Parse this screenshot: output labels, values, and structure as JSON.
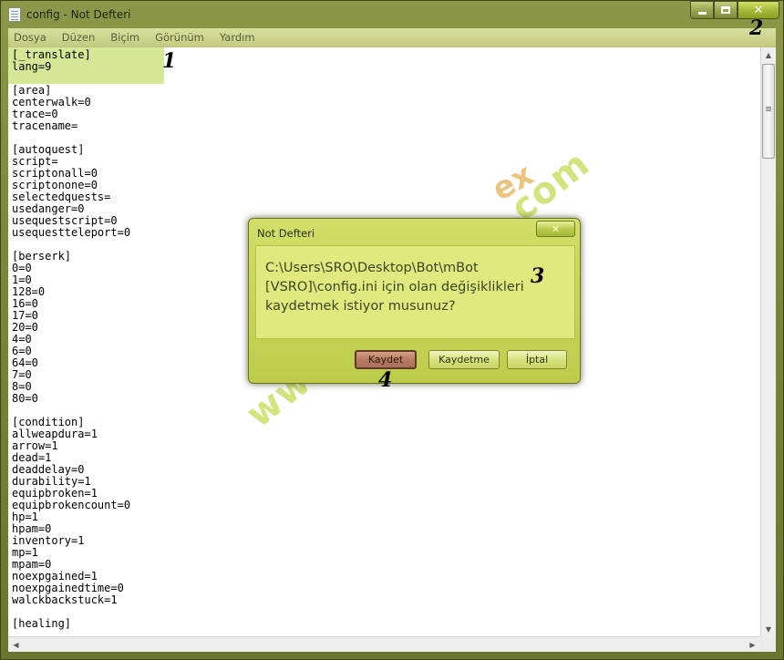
{
  "window": {
    "title": "config - Not Defteri",
    "icon": "notepad-icon",
    "caption_buttons": {
      "minimize": "minimize-icon",
      "maximize": "maximize-icon",
      "close": "✕"
    }
  },
  "menu": [
    "Dosya",
    "Düzen",
    "Biçim",
    "Görünüm",
    "Yardım"
  ],
  "editor": {
    "lines": [
      "[_translate]",
      "lang=9",
      "",
      "[area]",
      "centerwalk=0",
      "trace=0",
      "tracename=",
      "",
      "[autoquest]",
      "script=",
      "scriptonall=0",
      "scriptonone=0",
      "selectedquests=",
      "usedanger=0",
      "usequestscript=0",
      "usequestteleport=0",
      "",
      "[berserk]",
      "0=0",
      "1=0",
      "128=0",
      "16=0",
      "17=0",
      "20=0",
      "4=0",
      "6=0",
      "64=0",
      "7=0",
      "8=0",
      "80=0",
      "",
      "[condition]",
      "allweapdura=1",
      "arrow=1",
      "dead=1",
      "deaddelay=0",
      "durability=1",
      "equipbroken=1",
      "equipbrokencount=0",
      "hp=1",
      "hpam=0",
      "inventory=1",
      "mp=1",
      "mpam=0",
      "noexpgained=1",
      "noexpgainedtime=0",
      "walckbackstuck=1",
      "",
      "[healing]"
    ],
    "highlight_color": "#cfe58a"
  },
  "dialog": {
    "title": "Not Defteri",
    "close_label": "✕",
    "message": "C:\\Users\\SRO\\Desktop\\Bot\\mBot\n[VSRO]\\config.ini için olan değişiklikleri\nkaydetmek istiyor musunuz?",
    "buttons": {
      "save": "Kaydet",
      "dont_save": "Kaydetme",
      "cancel": "İptal"
    }
  },
  "annotations": {
    "m1": "1",
    "m2": "2",
    "m3": "3",
    "m4": "4"
  },
  "watermark": {
    "text": "www.extralaab.com",
    "logo": "ex"
  },
  "colors": {
    "accent": "#bccc4a",
    "frame": "#7a8638",
    "default_button": "#b87c64"
  }
}
